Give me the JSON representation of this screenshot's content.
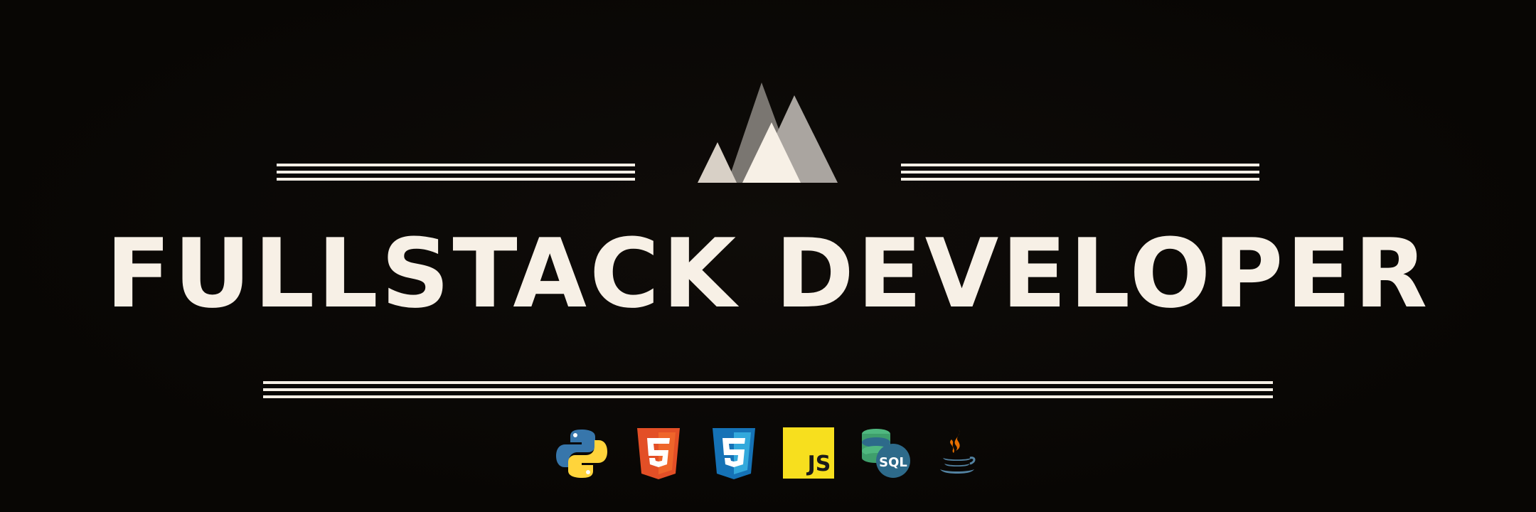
{
  "banner": {
    "headline": "FULLSTACK DEVELOPER",
    "logo": "mountain-logo",
    "text_color": "#f7f0e6",
    "background_color": "#0a0806"
  },
  "tech_icons": [
    {
      "name": "python-icon",
      "color": "#3776ab"
    },
    {
      "name": "html5-icon",
      "color": "#e34f26"
    },
    {
      "name": "css3-icon",
      "color": "#1572b6"
    },
    {
      "name": "javascript-icon",
      "label": "JS",
      "color": "#f7df1e"
    },
    {
      "name": "sql-database-icon",
      "label": "SQL",
      "color": "#2d6a8a"
    },
    {
      "name": "java-icon",
      "color": "#e76f00"
    }
  ]
}
